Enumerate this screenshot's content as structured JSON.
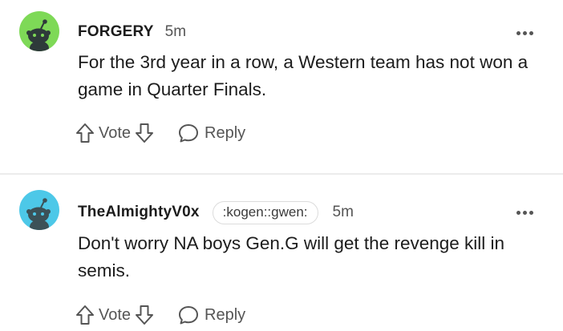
{
  "comments": [
    {
      "username": "FORGERY",
      "timestamp": "5m",
      "body": "For the 3rd year in a row, a Western team has not won a game in Quarter Finals.",
      "vote_label": "Vote",
      "reply_label": "Reply",
      "avatar_bg": "#7ed957",
      "icons": [
        "snoo-avatar-icon",
        "more-options-icon",
        "upvote-arrow-icon",
        "downvote-arrow-icon",
        "reply-bubble-icon"
      ]
    },
    {
      "username": "TheAlmightyV0x",
      "flair": ":kogen::gwen:",
      "timestamp": "5m",
      "body": "Don't worry NA boys Gen.G will get the revenge kill in semis.",
      "vote_label": "Vote",
      "reply_label": "Reply",
      "avatar_bg": "#4dc8e8",
      "icons": [
        "snoo-avatar-icon",
        "more-options-icon",
        "upvote-arrow-icon",
        "downvote-arrow-icon",
        "reply-bubble-icon"
      ]
    }
  ],
  "colors": {
    "text_primary": "#1c1c1c",
    "text_secondary": "#555555",
    "divider": "#ececec"
  }
}
